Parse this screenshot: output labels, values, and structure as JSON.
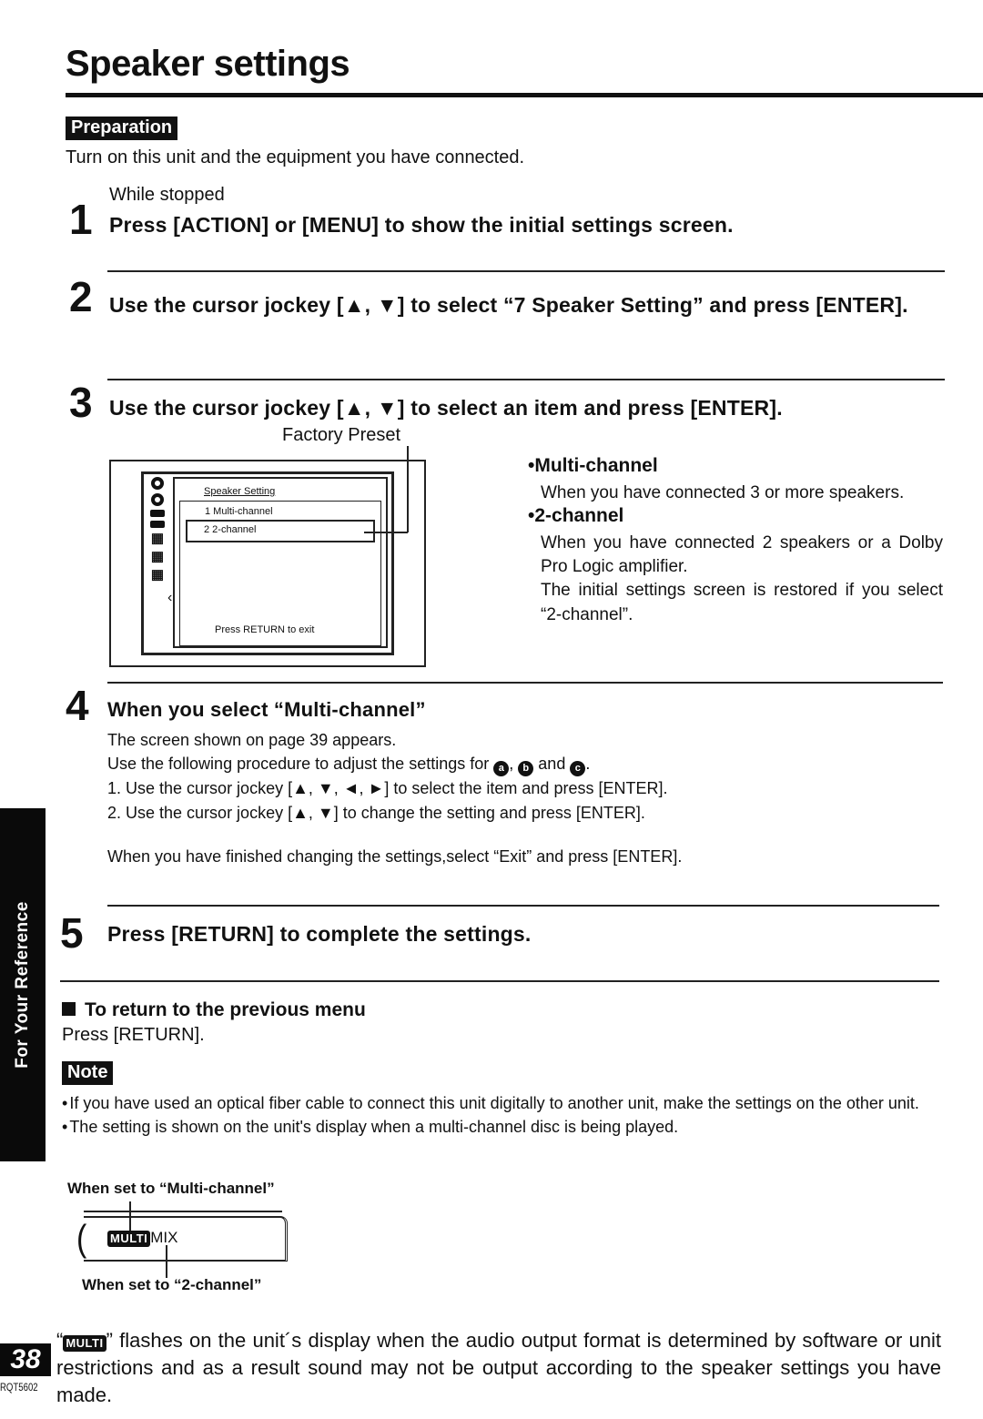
{
  "page": {
    "title": "Speaker settings",
    "side_tab": "For Your Reference",
    "page_number": "38",
    "doc_code": "RQT5602"
  },
  "preparation": {
    "label": "Preparation",
    "text": "Turn on this unit and the equipment you have connected."
  },
  "steps": [
    {
      "number": "1",
      "sub": "While stopped",
      "main": "Press [ACTION] or [MENU] to show the initial settings screen."
    },
    {
      "number": "2",
      "main": "Use the cursor jockey [▲, ▼] to select “7 Speaker Setting” and press [ENTER]."
    },
    {
      "number": "3",
      "main": "Use the cursor jockey [▲, ▼] to select an item and press [ENTER].",
      "factory_preset_label": "Factory Preset",
      "screen": {
        "title": "Speaker Setting",
        "options": [
          "1   Multi-channel",
          "2   2-channel"
        ],
        "selected_index": 1,
        "footer": "Press RETURN to exit",
        "icons": [
          "disc-icon",
          "disc-icon",
          "bar-icon",
          "bar-icon",
          "grid-icon",
          "grid-icon",
          "grid-icon"
        ]
      },
      "options": [
        {
          "head": "•Multi-channel",
          "text": "When you have connected 3 or more speakers."
        },
        {
          "head": "•2-channel",
          "text": "When you have connected 2 speakers or a Dolby Pro Logic amplifier.",
          "text2": "The initial settings screen is restored if you select “2-channel”."
        }
      ]
    },
    {
      "number": "4",
      "main": "When you select “Multi-channel”",
      "lines": {
        "l1": "The screen shown on page 39 appears.",
        "l2_prefix": "Use the following procedure to adjust the settings for",
        "marker_a": "a",
        "marker_b": "b",
        "marker_c": "c",
        "l2_and": "and",
        "l3": "1. Use the cursor jockey [▲, ▼, ◄, ►] to select the item and press [ENTER].",
        "l4": "2. Use the cursor jockey [▲, ▼] to change the setting and press [ENTER]."
      },
      "finish": "When you have finished changing the settings,select “Exit” and press [ENTER]."
    },
    {
      "number": "5",
      "main": "Press [RETURN] to complete the settings."
    }
  ],
  "return_section": {
    "heading": "To return to the previous menu",
    "text": "Press [RETURN]."
  },
  "note": {
    "label": "Note",
    "items": [
      "If you have used an optical fiber cable to connect this unit digitally to another unit, make the settings on the other unit.",
      "The setting is shown on the unit's display when a multi-channel disc is being played."
    ]
  },
  "display_diagram": {
    "label_multi": "When set to “Multi-channel”",
    "label_2ch": "When set to “2-channel”",
    "badge": "MULTI",
    "mix": "MIX"
  },
  "footer": {
    "quote_open": "“",
    "badge": "MULTI",
    "text": "” flashes on the unit´s display when the audio output format is determined by software or unit restrictions and as a result sound may not be output according to the speaker settings you have made."
  }
}
